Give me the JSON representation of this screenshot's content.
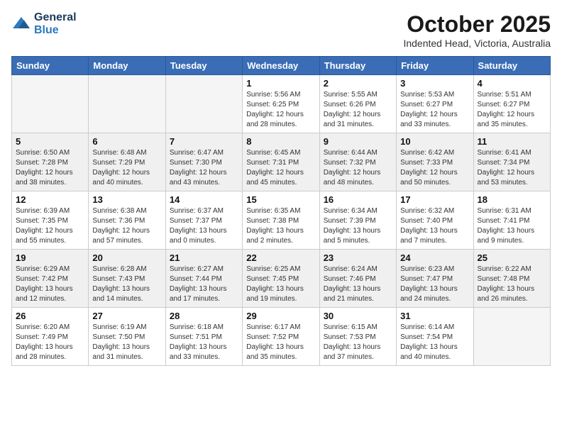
{
  "header": {
    "logo_line1": "General",
    "logo_line2": "Blue",
    "month": "October 2025",
    "location": "Indented Head, Victoria, Australia"
  },
  "weekdays": [
    "Sunday",
    "Monday",
    "Tuesday",
    "Wednesday",
    "Thursday",
    "Friday",
    "Saturday"
  ],
  "weeks": [
    [
      {
        "day": "",
        "info": ""
      },
      {
        "day": "",
        "info": ""
      },
      {
        "day": "",
        "info": ""
      },
      {
        "day": "1",
        "info": "Sunrise: 5:56 AM\nSunset: 6:25 PM\nDaylight: 12 hours\nand 28 minutes."
      },
      {
        "day": "2",
        "info": "Sunrise: 5:55 AM\nSunset: 6:26 PM\nDaylight: 12 hours\nand 31 minutes."
      },
      {
        "day": "3",
        "info": "Sunrise: 5:53 AM\nSunset: 6:27 PM\nDaylight: 12 hours\nand 33 minutes."
      },
      {
        "day": "4",
        "info": "Sunrise: 5:51 AM\nSunset: 6:27 PM\nDaylight: 12 hours\nand 35 minutes."
      }
    ],
    [
      {
        "day": "5",
        "info": "Sunrise: 6:50 AM\nSunset: 7:28 PM\nDaylight: 12 hours\nand 38 minutes."
      },
      {
        "day": "6",
        "info": "Sunrise: 6:48 AM\nSunset: 7:29 PM\nDaylight: 12 hours\nand 40 minutes."
      },
      {
        "day": "7",
        "info": "Sunrise: 6:47 AM\nSunset: 7:30 PM\nDaylight: 12 hours\nand 43 minutes."
      },
      {
        "day": "8",
        "info": "Sunrise: 6:45 AM\nSunset: 7:31 PM\nDaylight: 12 hours\nand 45 minutes."
      },
      {
        "day": "9",
        "info": "Sunrise: 6:44 AM\nSunset: 7:32 PM\nDaylight: 12 hours\nand 48 minutes."
      },
      {
        "day": "10",
        "info": "Sunrise: 6:42 AM\nSunset: 7:33 PM\nDaylight: 12 hours\nand 50 minutes."
      },
      {
        "day": "11",
        "info": "Sunrise: 6:41 AM\nSunset: 7:34 PM\nDaylight: 12 hours\nand 53 minutes."
      }
    ],
    [
      {
        "day": "12",
        "info": "Sunrise: 6:39 AM\nSunset: 7:35 PM\nDaylight: 12 hours\nand 55 minutes."
      },
      {
        "day": "13",
        "info": "Sunrise: 6:38 AM\nSunset: 7:36 PM\nDaylight: 12 hours\nand 57 minutes."
      },
      {
        "day": "14",
        "info": "Sunrise: 6:37 AM\nSunset: 7:37 PM\nDaylight: 13 hours\nand 0 minutes."
      },
      {
        "day": "15",
        "info": "Sunrise: 6:35 AM\nSunset: 7:38 PM\nDaylight: 13 hours\nand 2 minutes."
      },
      {
        "day": "16",
        "info": "Sunrise: 6:34 AM\nSunset: 7:39 PM\nDaylight: 13 hours\nand 5 minutes."
      },
      {
        "day": "17",
        "info": "Sunrise: 6:32 AM\nSunset: 7:40 PM\nDaylight: 13 hours\nand 7 minutes."
      },
      {
        "day": "18",
        "info": "Sunrise: 6:31 AM\nSunset: 7:41 PM\nDaylight: 13 hours\nand 9 minutes."
      }
    ],
    [
      {
        "day": "19",
        "info": "Sunrise: 6:29 AM\nSunset: 7:42 PM\nDaylight: 13 hours\nand 12 minutes."
      },
      {
        "day": "20",
        "info": "Sunrise: 6:28 AM\nSunset: 7:43 PM\nDaylight: 13 hours\nand 14 minutes."
      },
      {
        "day": "21",
        "info": "Sunrise: 6:27 AM\nSunset: 7:44 PM\nDaylight: 13 hours\nand 17 minutes."
      },
      {
        "day": "22",
        "info": "Sunrise: 6:25 AM\nSunset: 7:45 PM\nDaylight: 13 hours\nand 19 minutes."
      },
      {
        "day": "23",
        "info": "Sunrise: 6:24 AM\nSunset: 7:46 PM\nDaylight: 13 hours\nand 21 minutes."
      },
      {
        "day": "24",
        "info": "Sunrise: 6:23 AM\nSunset: 7:47 PM\nDaylight: 13 hours\nand 24 minutes."
      },
      {
        "day": "25",
        "info": "Sunrise: 6:22 AM\nSunset: 7:48 PM\nDaylight: 13 hours\nand 26 minutes."
      }
    ],
    [
      {
        "day": "26",
        "info": "Sunrise: 6:20 AM\nSunset: 7:49 PM\nDaylight: 13 hours\nand 28 minutes."
      },
      {
        "day": "27",
        "info": "Sunrise: 6:19 AM\nSunset: 7:50 PM\nDaylight: 13 hours\nand 31 minutes."
      },
      {
        "day": "28",
        "info": "Sunrise: 6:18 AM\nSunset: 7:51 PM\nDaylight: 13 hours\nand 33 minutes."
      },
      {
        "day": "29",
        "info": "Sunrise: 6:17 AM\nSunset: 7:52 PM\nDaylight: 13 hours\nand 35 minutes."
      },
      {
        "day": "30",
        "info": "Sunrise: 6:15 AM\nSunset: 7:53 PM\nDaylight: 13 hours\nand 37 minutes."
      },
      {
        "day": "31",
        "info": "Sunrise: 6:14 AM\nSunset: 7:54 PM\nDaylight: 13 hours\nand 40 minutes."
      },
      {
        "day": "",
        "info": ""
      }
    ]
  ]
}
